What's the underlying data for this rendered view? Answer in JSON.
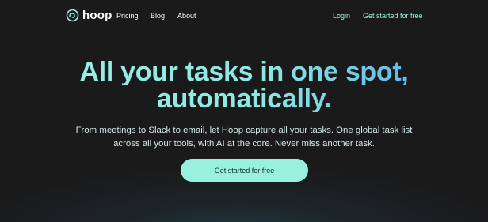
{
  "nav": {
    "logo_text": "hoop",
    "links": [
      "Pricing",
      "Blog",
      "About"
    ],
    "login": "Login",
    "get_started": "Get started for free"
  },
  "hero": {
    "title_line1_plain": "All your tasks in one ",
    "title_line1_accent": "spot,",
    "title_line2": "automatically.",
    "subtitle": "From meetings to Slack to email, let Hoop capture all your tasks. One global task list across all your tools, with AI at the core. Never miss another task.",
    "cta": "Get started for free"
  },
  "colors": {
    "background": "#1a1a1b",
    "accent": "#98f0df",
    "title_gradient_start": "#9df2e4",
    "title_gradient_end": "#4ba3ea"
  },
  "icons": {
    "logo": "hoop-logo-icon"
  }
}
